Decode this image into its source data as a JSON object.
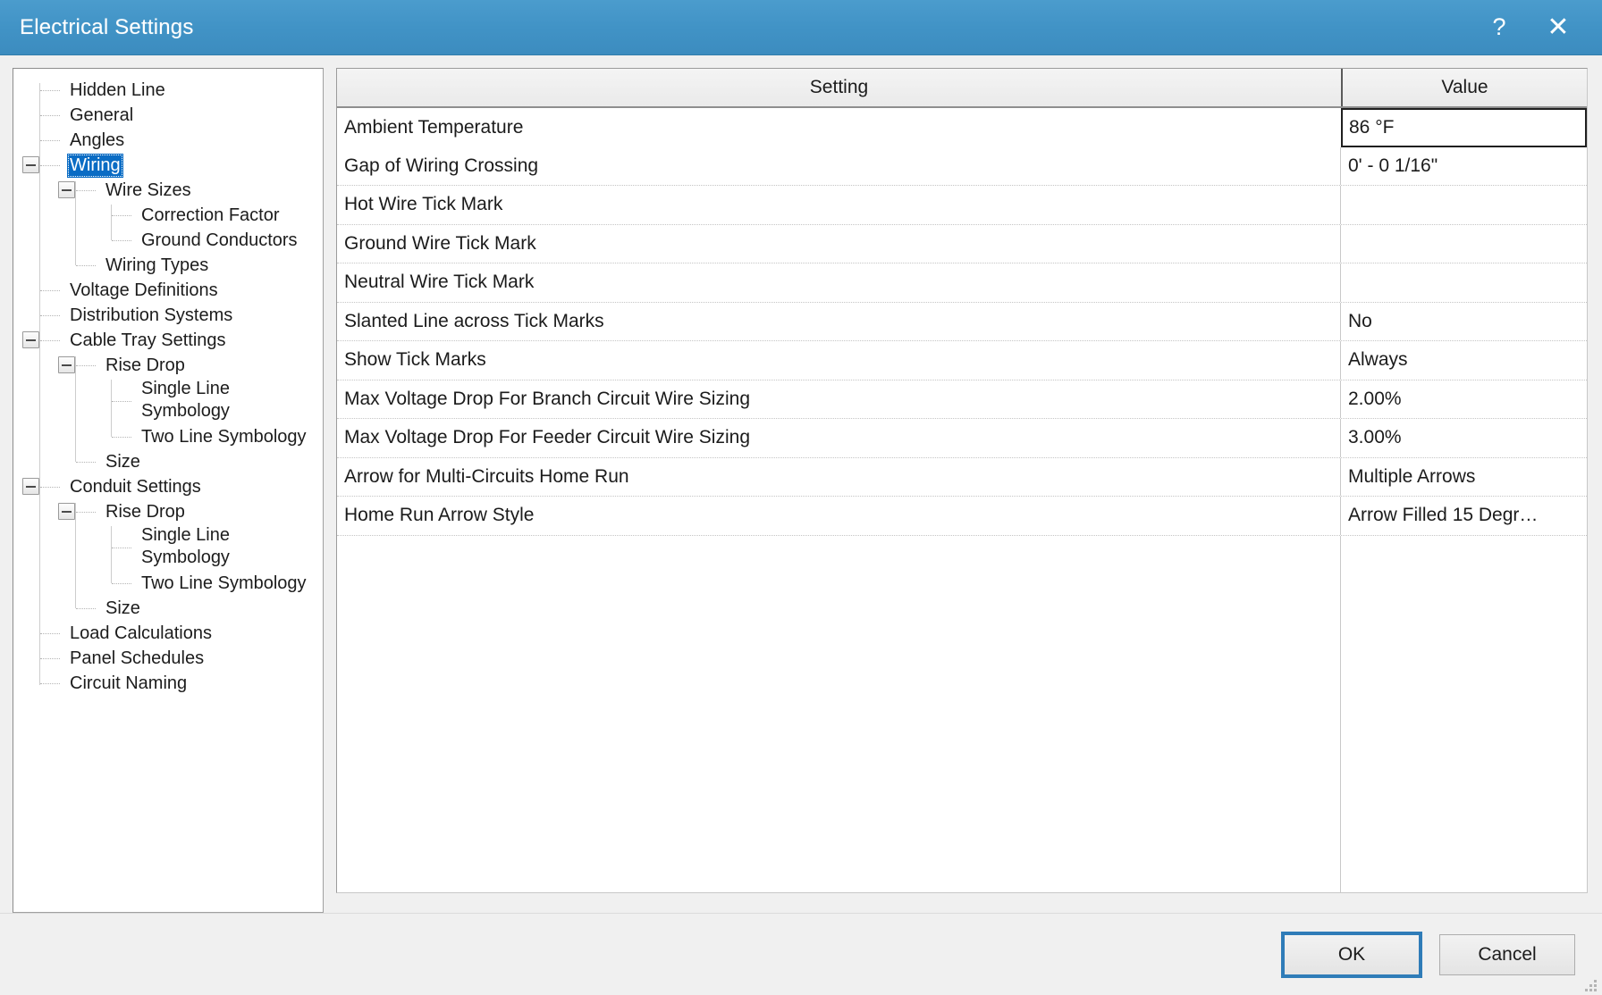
{
  "window": {
    "title": "Electrical Settings",
    "help_icon": "?",
    "close_icon": "✕"
  },
  "tree": {
    "nodes": [
      {
        "label": "Hidden Line",
        "depth": 1,
        "toggle": false,
        "selected": false
      },
      {
        "label": "General",
        "depth": 1,
        "toggle": false,
        "selected": false
      },
      {
        "label": "Angles",
        "depth": 1,
        "toggle": false,
        "selected": false
      },
      {
        "label": "Wiring",
        "depth": 1,
        "toggle": true,
        "selected": true
      },
      {
        "label": "Wire Sizes",
        "depth": 2,
        "toggle": true,
        "selected": false
      },
      {
        "label": "Correction Factor",
        "depth": 3,
        "toggle": false,
        "selected": false
      },
      {
        "label": "Ground Conductors",
        "depth": 3,
        "toggle": false,
        "selected": false
      },
      {
        "label": "Wiring Types",
        "depth": 2,
        "toggle": false,
        "selected": false
      },
      {
        "label": "Voltage Definitions",
        "depth": 1,
        "toggle": false,
        "selected": false
      },
      {
        "label": "Distribution Systems",
        "depth": 1,
        "toggle": false,
        "selected": false
      },
      {
        "label": "Cable Tray Settings",
        "depth": 1,
        "toggle": true,
        "selected": false
      },
      {
        "label": "Rise Drop",
        "depth": 2,
        "toggle": true,
        "selected": false
      },
      {
        "label": "Single Line Symbology",
        "depth": 3,
        "toggle": false,
        "selected": false,
        "wrap": true
      },
      {
        "label": "Two Line Symbology",
        "depth": 3,
        "toggle": false,
        "selected": false
      },
      {
        "label": "Size",
        "depth": 2,
        "toggle": false,
        "selected": false
      },
      {
        "label": "Conduit Settings",
        "depth": 1,
        "toggle": true,
        "selected": false
      },
      {
        "label": "Rise Drop",
        "depth": 2,
        "toggle": true,
        "selected": false
      },
      {
        "label": "Single Line Symbology",
        "depth": 3,
        "toggle": false,
        "selected": false,
        "wrap": true
      },
      {
        "label": "Two Line Symbology",
        "depth": 3,
        "toggle": false,
        "selected": false
      },
      {
        "label": "Size",
        "depth": 2,
        "toggle": false,
        "selected": false
      },
      {
        "label": "Load Calculations",
        "depth": 1,
        "toggle": false,
        "selected": false
      },
      {
        "label": "Panel Schedules",
        "depth": 1,
        "toggle": false,
        "selected": false
      },
      {
        "label": "Circuit Naming",
        "depth": 1,
        "toggle": false,
        "selected": false
      }
    ]
  },
  "grid": {
    "columns": [
      "Setting",
      "Value"
    ],
    "rows": [
      {
        "setting": "Ambient Temperature",
        "value": "86 °F",
        "focused": true
      },
      {
        "setting": "Gap of Wiring Crossing",
        "value": "0' - 0 1/16\"",
        "focused": false
      },
      {
        "setting": "Hot Wire Tick Mark",
        "value": "",
        "focused": false
      },
      {
        "setting": "Ground Wire Tick Mark",
        "value": "",
        "focused": false
      },
      {
        "setting": "Neutral Wire Tick Mark",
        "value": "",
        "focused": false
      },
      {
        "setting": "Slanted Line across Tick Marks",
        "value": "No",
        "focused": false
      },
      {
        "setting": "Show Tick Marks",
        "value": "Always",
        "focused": false
      },
      {
        "setting": "Max Voltage Drop For Branch Circuit Wire Sizing",
        "value": "2.00%",
        "focused": false
      },
      {
        "setting": "Max Voltage Drop For Feeder Circuit Wire Sizing",
        "value": "3.00%",
        "focused": false
      },
      {
        "setting": "Arrow for Multi-Circuits Home Run",
        "value": "Multiple Arrows",
        "focused": false
      },
      {
        "setting": "Home Run Arrow Style",
        "value": "Arrow Filled 15 Degr…",
        "focused": false
      }
    ]
  },
  "footer": {
    "ok_label": "OK",
    "cancel_label": "Cancel"
  },
  "colors": {
    "titlebar": "#4193c6",
    "selection": "#0a6cc4",
    "default_button_focus": "#2f7cb8"
  }
}
